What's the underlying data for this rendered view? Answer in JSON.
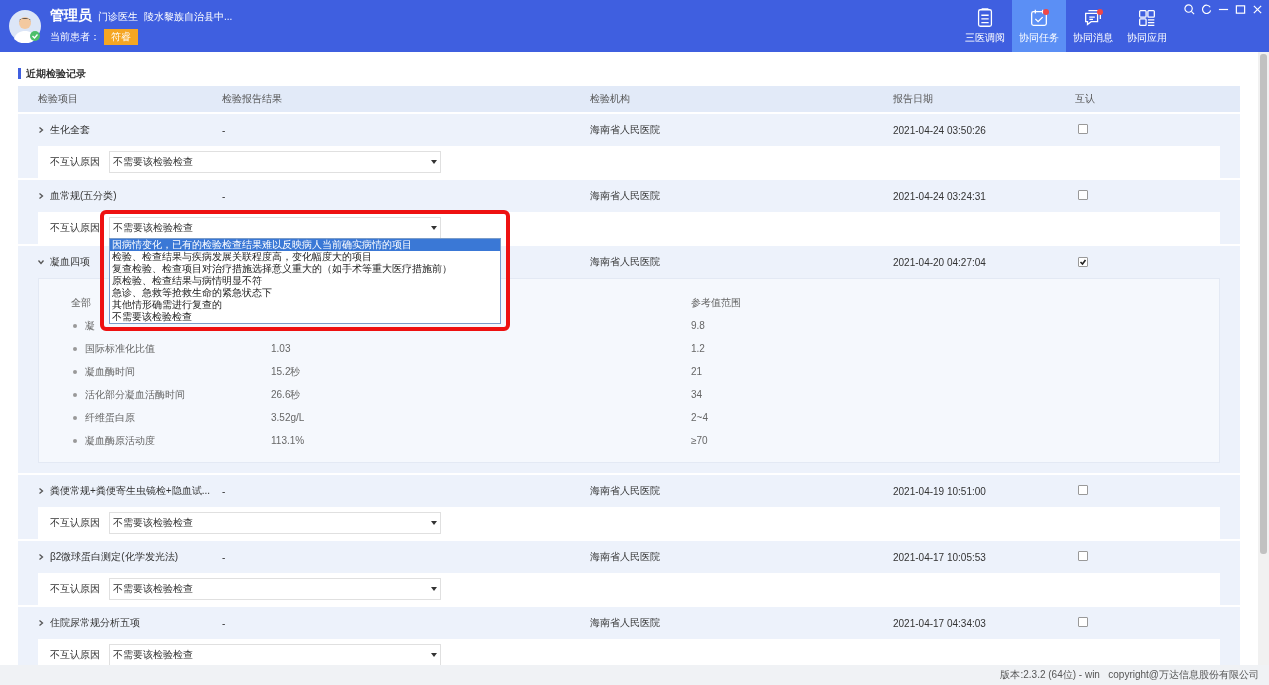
{
  "header": {
    "user_name": "管理员",
    "role": "门诊医生",
    "hospital": "陵水黎族自治县中...",
    "patient_label": "当前患者：",
    "patient_name": "符睿"
  },
  "nav": [
    {
      "kind": "doc",
      "label": "三医调阅",
      "selected": false,
      "badge": false
    },
    {
      "kind": "task",
      "label": "协同任务",
      "selected": true,
      "badge": true
    },
    {
      "kind": "chat",
      "label": "协同消息",
      "selected": false,
      "badge": true
    },
    {
      "kind": "apps",
      "label": "协同应用",
      "selected": false,
      "badge": false
    }
  ],
  "section_title": "近期检验记录",
  "table": {
    "columns": [
      "检验项目",
      "检验报告结果",
      "检验机构",
      "报告日期",
      "互认"
    ]
  },
  "records": [
    {
      "name": "生化全套",
      "expanded": false,
      "result": "-",
      "org": "海南省人民医院",
      "date": "2021-04-24 03:50:26",
      "mutual": false,
      "reason": {
        "label": "不互认原因",
        "value": "不需要该检验检查",
        "open": false
      }
    },
    {
      "name": "血常规(五分类)",
      "expanded": false,
      "result": "-",
      "org": "海南省人民医院",
      "date": "2021-04-24 03:24:31",
      "mutual": false,
      "reason": {
        "label": "不互认原因",
        "value": "不需要该检验检查",
        "open": true,
        "options": [
          {
            "label": "因病情变化，已有的检验检查结果难以反映病人当前确实病情的项目",
            "highlighted": true
          },
          {
            "label": "检验、检查结果与疾病发展关联程度高，变化幅度大的项目",
            "highlighted": false
          },
          {
            "label": "复查检验、检查项目对治疗措施选择意义重大的（如手术等重大医疗措施前）",
            "highlighted": false
          },
          {
            "label": "原检验、检查结果与病情明显不符",
            "highlighted": false
          },
          {
            "label": "急诊、急救等抢救生命的紧急状态下",
            "highlighted": false
          },
          {
            "label": "其他情形确需进行复查的",
            "highlighted": false
          },
          {
            "label": "不需要该检验检查",
            "highlighted": false
          }
        ]
      }
    },
    {
      "name": "凝血四项",
      "expanded": true,
      "org": "海南省人民医院",
      "date": "2021-04-20 04:27:04",
      "mutual": true,
      "details": {
        "columns": [
          "全部",
          "参考值范围"
        ],
        "items": [
          {
            "name": "凝",
            "ref": "9.8"
          },
          {
            "name": "国际标准化比值",
            "value": "1.03",
            "ref": "1.2"
          },
          {
            "name": "凝血酶时间",
            "value": "15.2秒",
            "ref": "21"
          },
          {
            "name": "活化部分凝血活酶时间",
            "value": "26.6秒",
            "ref": "34"
          },
          {
            "name": "纤维蛋白原",
            "value": "3.52g/L",
            "ref": "2~4"
          },
          {
            "name": "凝血酶原活动度",
            "value": "113.1%",
            "ref": "≥70"
          }
        ]
      }
    },
    {
      "name": "粪便常规+粪便寄生虫镜检+隐血试...",
      "expanded": false,
      "result": "-",
      "org": "海南省人民医院",
      "date": "2021-04-19 10:51:00",
      "mutual": false,
      "reason": {
        "label": "不互认原因",
        "value": "不需要该检验检查",
        "open": false
      }
    },
    {
      "name": "β2微球蛋白测定(化学发光法)",
      "expanded": false,
      "result": "-",
      "org": "海南省人民医院",
      "date": "2021-04-17 10:05:53",
      "mutual": false,
      "reason": {
        "label": "不互认原因",
        "value": "不需要该检验检查",
        "open": false
      }
    },
    {
      "name": "住院尿常规分析五项",
      "expanded": false,
      "result": "-",
      "org": "海南省人民医院",
      "date": "2021-04-17 04:34:03",
      "mutual": false,
      "reason": {
        "label": "不互认原因",
        "value": "不需要该检验检查",
        "open": false
      }
    }
  ],
  "footer": "版本:2.3.2 (64位) - win   copyright@万达信息股份有限公司"
}
